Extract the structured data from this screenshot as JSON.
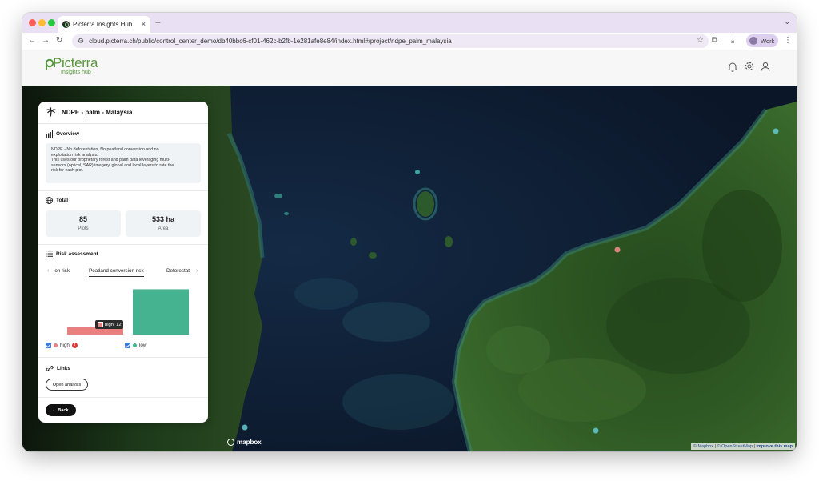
{
  "browser": {
    "tab_title": "Picterra Insights Hub",
    "tab_close": "×",
    "new_tab": "+",
    "url": "cloud.picterra.ch/public/control_center_demo/db40bbc6-cf01-462c-b2fb-1e281afe8e84/index.html#/project/ndpe_palm_malaysia",
    "profile_label": "Work"
  },
  "app": {
    "logo_text": "Picterra",
    "logo_subtext": "Insights hub"
  },
  "panel": {
    "title": "NDPE - palm - Malaysia",
    "overview": {
      "heading": "Overview",
      "lines": [
        "NDPE - No deforestation, No peatland conversion and no",
        "exploitation risk analysis.",
        "This uses our proprietary forest and palm data leveraging multi-",
        "sensors (optical, SAR) imagery, global and local layers to rate the",
        "risk for each plot."
      ]
    },
    "total": {
      "heading": "Total",
      "plots_value": "85",
      "plots_label": "Plots",
      "area_value": "533 ha",
      "area_label": "Area"
    },
    "risk": {
      "heading": "Risk assessment",
      "tabs": [
        "ion risk",
        "Peatland conversion risk",
        "Deforestat"
      ],
      "active_tab": "Peatland conversion risk",
      "tooltip": "high: 12",
      "legend_high": "high",
      "legend_low": "low",
      "warn_symbol": "!"
    },
    "links": {
      "heading": "Links",
      "open_analysis": "Open analysis"
    },
    "back_label": "Back",
    "back_arrow": "‹"
  },
  "chart_data": {
    "type": "bar",
    "categories": [
      "high",
      "low"
    ],
    "values": [
      12,
      73
    ],
    "colors": [
      "#e88080",
      "#45b38f"
    ],
    "ylim": [
      0,
      80
    ]
  },
  "map": {
    "attribution_mapbox": "© Mapbox",
    "attribution_osm": "© OpenStreetMap",
    "attribution_improve": "Improve this map",
    "mapbox_label": "mapbox",
    "marker_colors": [
      "#5fc3c8",
      "#e88a8a"
    ]
  }
}
